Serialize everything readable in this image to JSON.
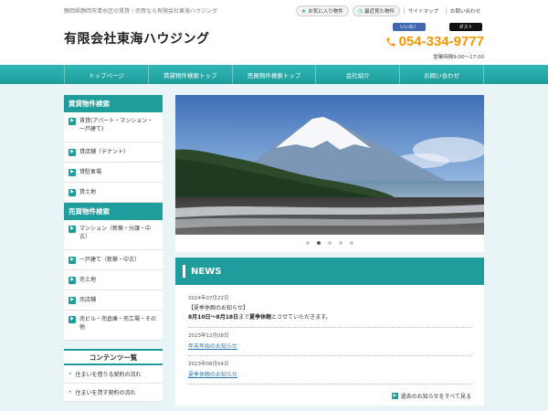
{
  "header": {
    "tagline": "静岡県静岡市清水区の賃貸・売買なら有限会社東海ハウジング",
    "favorites_label": "お気に入り物件",
    "recent_label": "最近見た物件",
    "sitemap_label": "サイトマップ",
    "contact_label": "お問い合わせ",
    "logo": "有限会社東海ハウジング",
    "fb_like": "いいね！",
    "tweet": "ポスト",
    "phone": "054-334-9777",
    "hours": "営業時間9:00～17:00"
  },
  "gnav": [
    "トップページ",
    "賃貸物件検索トップ",
    "売買物件検索トップ",
    "会社紹介",
    "お問い合わせ"
  ],
  "sidebar": {
    "rent_head": "賃貸物件検索",
    "rent_items": [
      "賃貸(アパート・マンション・一戸建て)",
      "貸店舗（テナント）",
      "貸駐車場",
      "貸土地"
    ],
    "sale_head": "売買物件検索",
    "sale_items": [
      "マンション（新築・分譲・中古）",
      "一戸建て（新築・中古）",
      "売土地",
      "売店舗",
      "売ビル・売倉庫・売工場・その他"
    ],
    "contents_head": "コンテンツ一覧",
    "contents_items": [
      "住まいを借りる契約の流れ",
      "住まいを貸す契約の流れ"
    ]
  },
  "slider": {
    "dot_count": 5,
    "active_index": 1
  },
  "news": {
    "title": "NEWS",
    "items": [
      {
        "date": "2024年07月22日",
        "line1": "【夏季休暇のお知らせ】",
        "bold1": "8月10日～8月18日",
        "mid": "まで",
        "bold2": "夏季休暇",
        "tail": "とさせていただきます。"
      },
      {
        "date": "2023年12月08日",
        "link": "年末年始のお知らせ"
      },
      {
        "date": "2023年08月04日",
        "link": "夏季休暇のお知らせ"
      }
    ],
    "more_label": "過去のお知らせをすべて見る"
  },
  "colors": {
    "accent": "#1f9c9c",
    "phone": "#f29600",
    "link": "#2a78b8"
  }
}
